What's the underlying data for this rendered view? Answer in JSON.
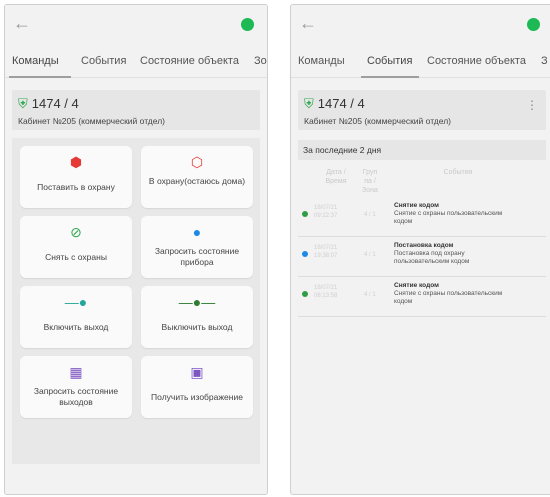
{
  "colors": {
    "status_green": "#1db954",
    "shield_green": "#2fa84f",
    "red": "#e53935",
    "blue": "#1e88e5",
    "teal": "#26a69a",
    "green_dark": "#2e7d32",
    "purple": "#7e57c2"
  },
  "left": {
    "tabs": [
      "Команды",
      "События",
      "Состояние объекта",
      "Зо"
    ],
    "object": {
      "id": "1474 / 4",
      "name": "Кабинет №205 (коммерческий отдел)"
    },
    "commands": [
      {
        "label": "Поставить в охрану",
        "icon": "shield-filled-red-icon"
      },
      {
        "label": "В охрану(остаюсь дома)",
        "icon": "shield-outline-red-icon"
      },
      {
        "label": "Снять с охраны",
        "icon": "shield-off-green-icon"
      },
      {
        "label": "Запросить состояние прибора",
        "icon": "info-blue-icon"
      },
      {
        "label": "Включить выход",
        "icon": "output-on-icon"
      },
      {
        "label": "Выключить выход",
        "icon": "output-off-icon"
      },
      {
        "label": "Запросить состояние выходов",
        "icon": "list-icon"
      },
      {
        "label": "Получить изображение",
        "icon": "camera-icon"
      }
    ]
  },
  "right": {
    "tabs": [
      "Команды",
      "События",
      "Состояние объекта",
      "З"
    ],
    "object": {
      "id": "1474 / 4",
      "name": "Кабинет №205 (коммерческий отдел)"
    },
    "period": "За последние 2 дня",
    "headers": {
      "date": "Дата / Время",
      "group": "Груп па / Зона",
      "event": "События"
    },
    "events": [
      {
        "date": "18/07/21 09:22:37",
        "zone": "4 / 1",
        "title": "Снятие кодом",
        "desc": "Снятие с охраны пользовательским кодом",
        "color": "#2e9d46"
      },
      {
        "date": "18/07/21 19:38:07",
        "zone": "4 / 1",
        "title": "Постановка кодом",
        "desc": "Постановка под охрану пользовательским кодом",
        "color": "#1e88e5"
      },
      {
        "date": "18/07/21 08:13:58",
        "zone": "4 / 1",
        "title": "Снятие кодом",
        "desc": "Снятие с охраны пользовательским кодом",
        "color": "#2e9d46"
      }
    ]
  }
}
